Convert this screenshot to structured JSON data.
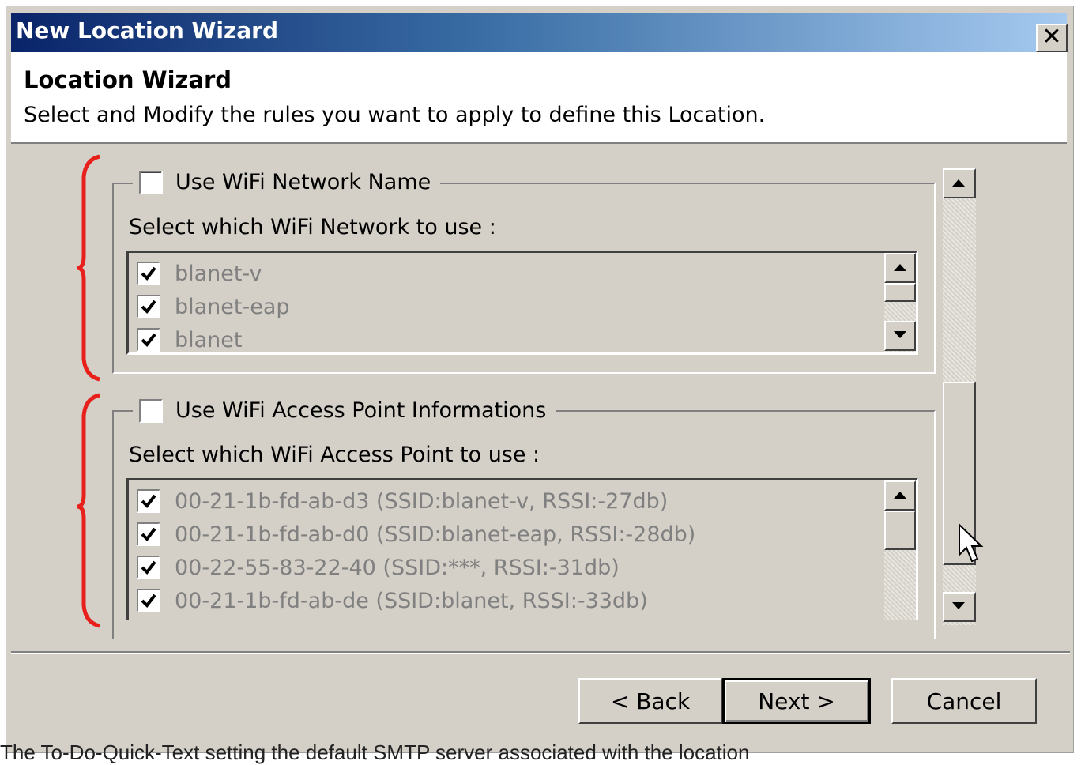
{
  "window": {
    "title": "New Location Wizard",
    "close_icon": "close-icon"
  },
  "header": {
    "title": "Location Wizard",
    "subtitle": "Select and Modify the rules you want to apply to define this Location."
  },
  "groups": {
    "wifi_network": {
      "checkbox_label": "Use WiFi Network Name",
      "checked": false,
      "select_label": "Select which WiFi Network to use :",
      "items": [
        {
          "label": "blanet-v",
          "checked": true
        },
        {
          "label": "blanet-eap",
          "checked": true
        },
        {
          "label": "blanet",
          "checked": true
        }
      ]
    },
    "wifi_ap": {
      "checkbox_label": "Use WiFi Access Point Informations",
      "checked": false,
      "select_label": "Select which WiFi Access Point to use :",
      "items": [
        {
          "label": "00-21-1b-fd-ab-d3 (SSID:blanet-v, RSSI:-27db)",
          "checked": true
        },
        {
          "label": "00-21-1b-fd-ab-d0 (SSID:blanet-eap, RSSI:-28db)",
          "checked": true
        },
        {
          "label": "00-22-55-83-22-40 (SSID:***, RSSI:-31db)",
          "checked": true
        },
        {
          "label": "00-21-1b-fd-ab-de (SSID:blanet, RSSI:-33db)",
          "checked": true
        }
      ]
    }
  },
  "buttons": {
    "back": "< Back",
    "next": "Next >",
    "cancel": "Cancel"
  },
  "colors": {
    "title_gradient_start": "#0a246a",
    "title_gradient_end": "#a6caf0",
    "annotation_brace": "#e8201c",
    "dialog_face": "#d4d0c8"
  },
  "caption": "The To-Do-Quick-Text setting the default SMTP server associated with the location"
}
